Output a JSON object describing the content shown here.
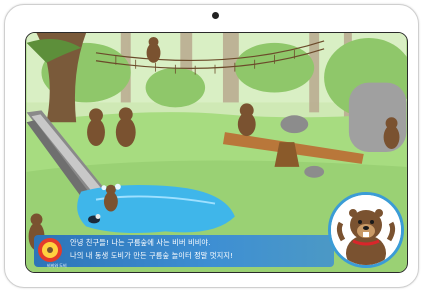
{
  "story": {
    "line1": "안녕 친구들! 나는 구름숲에 사는 비버 비비야.",
    "line2": "나의 내 동생 도비가 만든 구름숲 놀이터 정말 멋지지!"
  },
  "logo": {
    "sub_label": "비비와 도비"
  },
  "colors": {
    "grass": "#9fd77a",
    "water": "#3fb6ea",
    "dialog_blue": "#2d74b8",
    "beaver_brown": "#7a5230"
  },
  "icons": [
    "game-logo-icon",
    "beaver-character-icon"
  ]
}
